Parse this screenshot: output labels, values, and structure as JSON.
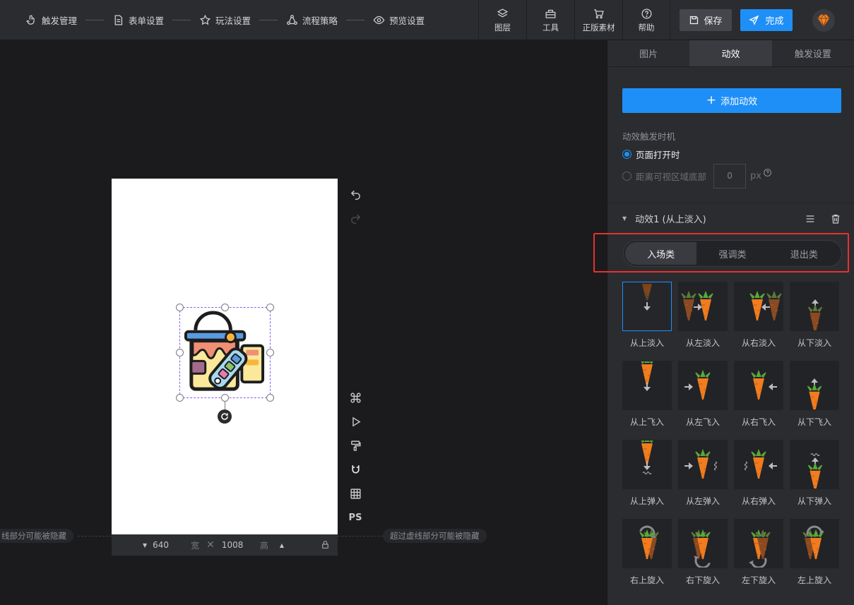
{
  "top_steps": [
    {
      "label": "触发管理",
      "icon": "touch-icon"
    },
    {
      "label": "表单设置",
      "icon": "form-icon"
    },
    {
      "label": "玩法设置",
      "icon": "star-icon"
    },
    {
      "label": "流程策略",
      "icon": "flow-icon"
    },
    {
      "label": "预览设置",
      "icon": "eye-icon"
    }
  ],
  "top_tools": [
    {
      "label": "图层",
      "icon": "layers-icon"
    },
    {
      "label": "工具",
      "icon": "toolbox-icon"
    },
    {
      "label": "正版素材",
      "icon": "cart-icon"
    },
    {
      "label": "帮助",
      "icon": "help-icon"
    }
  ],
  "actions": {
    "save_label": "保存",
    "done_label": "完成"
  },
  "canvas": {
    "width_value": "640",
    "width_unit": "宽",
    "height_value": "1008",
    "height_unit": "高",
    "hint_left": "线部分可能被隐藏",
    "hint_right": "超过虚线部分可能被隐藏",
    "ps_label": "PS"
  },
  "panel": {
    "tabs": [
      "图片",
      "动效",
      "触发设置"
    ],
    "active_tab": 1,
    "add_effect_label": "添加动效",
    "trigger_timing_label": "动效触发时机",
    "option_on_open": "页面打开时",
    "option_distance": "距离可视区域底部",
    "distance_value": "0",
    "distance_unit": "px",
    "effect_title": "动效1 (从上淡入)",
    "segments": [
      "入场类",
      "强调类",
      "退出类"
    ],
    "active_segment": 0,
    "effects": [
      "从上淡入",
      "从左淡入",
      "从右淡入",
      "从下淡入",
      "从上飞入",
      "从左飞入",
      "从右飞入",
      "从下飞入",
      "从上弹入",
      "从左弹入",
      "从右弹入",
      "从下弹入",
      "右上旋入",
      "右下旋入",
      "左下旋入",
      "左上旋入"
    ],
    "selected_effect": 0
  },
  "colors": {
    "accent": "#1e8ff7",
    "highlight": "#e5322d",
    "carrot": "#f07c1e"
  }
}
